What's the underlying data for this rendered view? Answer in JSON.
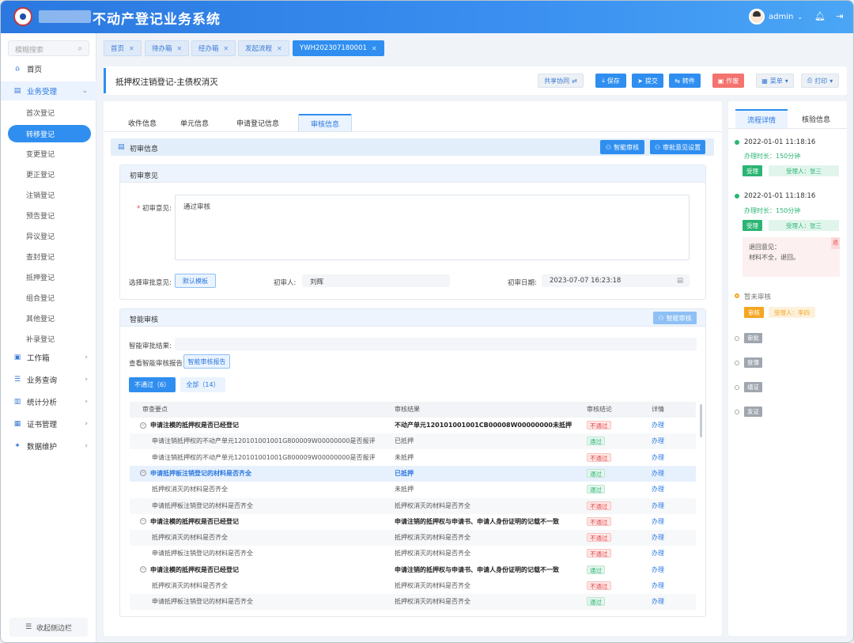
{
  "header": {
    "app_title": "不动产登记业务系统",
    "user_name": "admin"
  },
  "sidebar": {
    "search_placeholder": "模糊搜索",
    "home": "首页",
    "business": "业务受理",
    "sub_items": [
      "首次登记",
      "转移登记",
      "变更登记",
      "更正登记",
      "注销登记",
      "预告登记",
      "异议登记",
      "查封登记",
      "抵押登记",
      "组合登记",
      "其他登记",
      "补录登记"
    ],
    "bottom_items": [
      "工作箱",
      "业务查询",
      "统计分析",
      "证书管理",
      "数据维护"
    ],
    "collapse_label": "收起侧边栏"
  },
  "tabs": [
    "首页",
    "待办箱",
    "经办箱",
    "发起流程",
    "YWH202307180001"
  ],
  "page": {
    "title": "抵押权注销登记-主债权消灭",
    "buttons": {
      "share": "共享协同",
      "save": "保存",
      "submit": "提交",
      "transfer": "转件",
      "void": "作废",
      "menu": "菜单",
      "print": "打印"
    }
  },
  "main_tabs": [
    "收件信息",
    "单元信息",
    "申请登记信息",
    "审核信息"
  ],
  "section": {
    "title": "初审信息",
    "smart_btn": "智能审核",
    "opinion_setting_btn": "审批意见设置"
  },
  "first_review": {
    "card_title": "初审意见",
    "opinion_label": "初审意见:",
    "opinion_value": "通过审核",
    "select_label": "选择审批意见:",
    "template_btn": "默认模板",
    "reviewer_label": "初审人:",
    "reviewer_value": "刘辉",
    "date_label": "初审日期:",
    "date_value": "2023-07-07 16:23:18"
  },
  "smart_review": {
    "card_title": "智能审核",
    "smart_btn": "智能审核",
    "result_label": "智能审批结果:",
    "report_label": "查看智能审核报告:",
    "report_btn": "智能审核报告",
    "filter_fail": "不通过（6）",
    "filter_all": "全部（14）",
    "columns": [
      "审查要点",
      "审核结果",
      "审核结论",
      "详情"
    ],
    "rows": [
      {
        "type": "group",
        "point": "申请注模的抵押权是否已经登记",
        "result": "不动产单元120101001001CB00008W00000000未抵押",
        "conclusion": "不通过",
        "detail": "办理"
      },
      {
        "type": "child",
        "point": "申请注销抵押权的不动产单元120101001001G800009W00000000是否报评",
        "result": "已抵押",
        "conclusion": "通过",
        "detail": "办理"
      },
      {
        "type": "child",
        "point": "申请注销抵押权的不动产单元120101001001G800009W00000000是否报评",
        "result": "未抵押",
        "conclusion": "不通过",
        "detail": "办理"
      },
      {
        "type": "group-hl",
        "point": "申请抵押板注销登记的材料是否齐全",
        "result": "已抵押",
        "conclusion": "通过",
        "detail": "办理"
      },
      {
        "type": "child",
        "point": "抵押权消灭的材料是否齐全",
        "result": "未抵押",
        "conclusion": "通过",
        "detail": "办理"
      },
      {
        "type": "child",
        "point": "申请抵押板注销登记的材料是否齐全",
        "result": "抵押权消灭的材料是否齐全",
        "conclusion": "不通过",
        "detail": "办理"
      },
      {
        "type": "group",
        "point": "申请注模的抵押权是否已经登记",
        "result": "申请注销的抵押权与申请书、申请人身份证明的记载不一致",
        "conclusion": "不通过",
        "detail": "办理"
      },
      {
        "type": "child",
        "point": "抵押权消灭的材料是否齐全",
        "result": "抵押权消灭的材料是否齐全",
        "conclusion": "不通过",
        "detail": "办理"
      },
      {
        "type": "child",
        "point": "申请抵押板注销登记的材料是否齐全",
        "result": "抵押权消灭的材料是否齐全",
        "conclusion": "不通过",
        "detail": "办理"
      },
      {
        "type": "group",
        "point": "申请注模的抵押权是否已经登记",
        "result": "申请注销的抵押权与申请书、申请人身份证明的记载不一致",
        "conclusion": "通过",
        "detail": "办理"
      },
      {
        "type": "child",
        "point": "抵押权消灭的材料是否齐全",
        "result": "抵押权消灭的材料是否齐全",
        "conclusion": "不通过",
        "detail": "办理"
      },
      {
        "type": "child",
        "point": "申请抵押板注销登记的材料是否齐全",
        "result": "抵押权消灭的材料是否齐全",
        "conclusion": "通过",
        "detail": "办理"
      }
    ]
  },
  "right_panel": {
    "tabs": [
      "流程详情",
      "核验信息"
    ],
    "timeline": [
      {
        "time": "2022-01-01 11:18:16",
        "duration": "办理时长：150分钟",
        "stage": "受理",
        "handler": "受理人：张三"
      },
      {
        "time": "2022-01-01 11:18:16",
        "duration": "办理时长：150分钟",
        "stage": "受理",
        "handler": "受理人：张三"
      }
    ],
    "return_note": {
      "line1": "退回意见：",
      "line2": "材料不全，退回。",
      "corner": "退"
    },
    "pending": {
      "label": "暂未审核",
      "stage": "审核",
      "handler": "受理人：李四"
    },
    "future_stages": [
      "审批",
      "登簿",
      "缮证",
      "发证"
    ]
  }
}
